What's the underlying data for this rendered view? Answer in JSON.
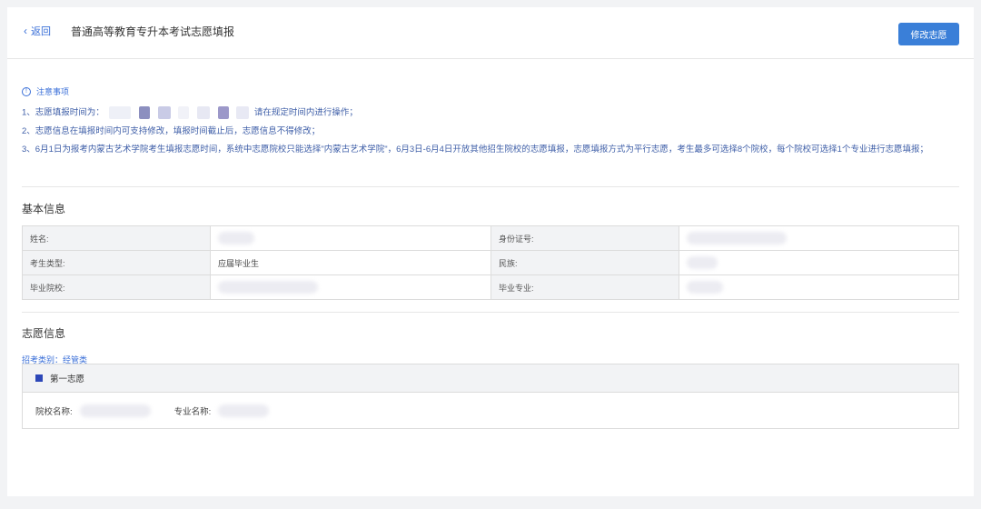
{
  "header": {
    "back_icon": "chevron-left-icon",
    "back_label": "返回",
    "title": "普通高等教育专升本考试志愿填报",
    "edit_button": "修改志愿"
  },
  "notes": {
    "heading": "注意事项",
    "items": [
      "1、志愿填报时间为：",
      "请在规定时间内进行操作；",
      "2、志愿信息在填报时间内可支持修改，填报时间截止后，志愿信息不得修改；",
      "3、6月1日为报考内蒙古艺术学院考生填报志愿时间，系统中志愿院校只能选择\"内蒙古艺术学院\"，6月3日-6月4日开放其他招生院校的志愿填报，志愿填报方式为平行志愿，考生最多可选择8个院校，每个院校可选择1个专业进行志愿填报；"
    ]
  },
  "basic_info": {
    "title": "基本信息",
    "rows": [
      {
        "label1": "姓名:",
        "value1": "",
        "label2": "身份证号:",
        "value2": ""
      },
      {
        "label1": "考生类型:",
        "value1": "应届毕业生",
        "label2": "民族:",
        "value2": ""
      },
      {
        "label1": "毕业院校:",
        "value1": "",
        "label2": "毕业专业:",
        "value2": ""
      }
    ]
  },
  "volunteer_info": {
    "title": "志愿信息",
    "category": "招考类别：经管类",
    "choice_title": "第一志愿",
    "school_label": "院校名称:",
    "major_label": "专业名称:"
  },
  "colors": {
    "accent": "#3a7fd8",
    "link": "#3a6fd8",
    "marker": "#2d47b8"
  }
}
